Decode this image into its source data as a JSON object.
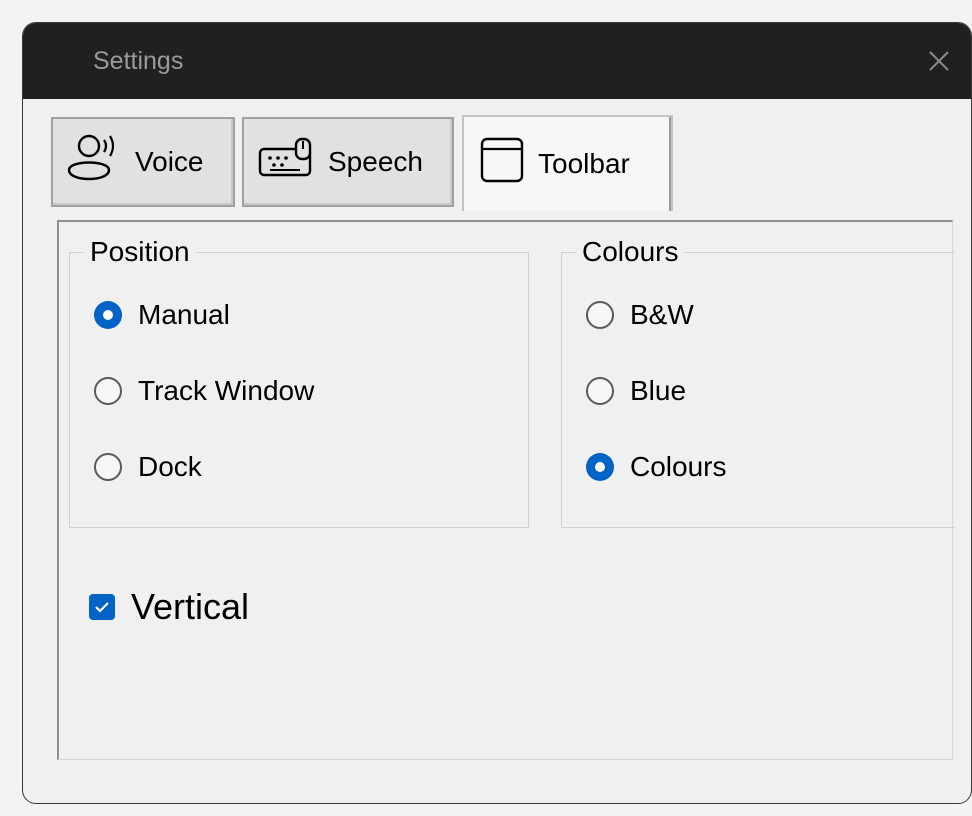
{
  "window": {
    "title": "Settings"
  },
  "tabs": [
    {
      "label": "Voice",
      "icon": "voice-icon",
      "active": false
    },
    {
      "label": "Speech",
      "icon": "speech-icon",
      "active": false
    },
    {
      "label": "Toolbar",
      "icon": "toolbar-icon",
      "active": true
    }
  ],
  "position_group": {
    "legend": "Position",
    "options": [
      {
        "label": "Manual",
        "checked": true
      },
      {
        "label": "Track Window",
        "checked": false
      },
      {
        "label": "Dock",
        "checked": false
      }
    ]
  },
  "colours_group": {
    "legend": "Colours",
    "options": [
      {
        "label": "B&W",
        "checked": false
      },
      {
        "label": "Blue",
        "checked": false
      },
      {
        "label": "Colours",
        "checked": true
      }
    ]
  },
  "vertical": {
    "label": "Vertical",
    "checked": true
  },
  "colors": {
    "titlebar": "#202020",
    "accent": "#0063c5",
    "window_bg": "#f0f0f0"
  }
}
